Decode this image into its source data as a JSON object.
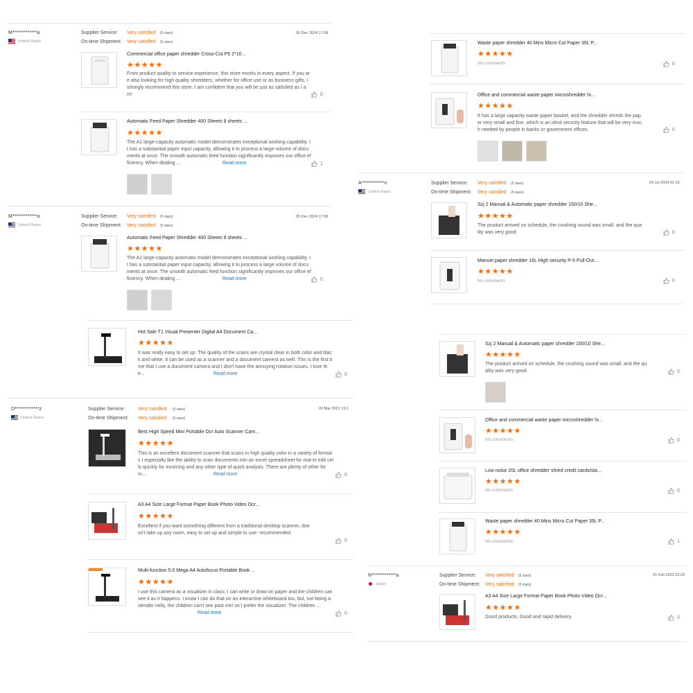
{
  "labels": {
    "supplier": "Supplier Service:",
    "ontime": "On-time Shipment:",
    "satisfied": "Very satisfied",
    "five": "(5 stars)",
    "read_more": "Read more",
    "no_comments": "No comments",
    "stars": "★★★★★"
  },
  "reviews": [
    {
      "user": "M*************a",
      "country": "United States",
      "date": "05 Dec 2024 17:58"
    },
    {
      "user": "M*************a",
      "country": "United States",
      "date": "05 Dec 2024 17:58"
    },
    {
      "user": "D*************z",
      "country": "United States",
      "date": "09 Mar 2021 19:1"
    },
    {
      "user": "A************n",
      "country": "United States",
      "date": "24 Jul 2024 01:19"
    },
    {
      "user": "N*************a",
      "country": "Japan",
      "date": "01 Feb 2023 22:29"
    }
  ],
  "items": [
    {
      "title": "Commercial office paper shredder Cross-Cut P5 2*10...",
      "text": "From product quality to service experience, this store excels in every aspect. If you are also looking for high quality shredders, whether for office use or as business gifts, I strongly recommend this store. I am confident that you will be just as satisfied as I am!",
      "likes": "0"
    },
    {
      "title": "Automatic Feed Paper Shredder 400 Sheets 8 sheets ...",
      "text": "The A1 large-capacity automatic model demonstrates exceptional working capability. It has a substantial paper input capacity, allowing it to process a large volume of documents at once. The smooth automatic feed function significantly improves our office efficiency. When dealing ...",
      "likes": "1"
    },
    {
      "title": "Automatic Feed Paper Shredder 400 Sheets 8 sheets ...",
      "text": "The A1 large-capacity automatic model demonstrates exceptional working capability. It has a substantial paper input capacity, allowing it to process a large volume of documents at once. The smooth automatic feed function significantly improves our office efficiency. When dealing ...",
      "likes": "0"
    },
    {
      "title": "Hot Sale T1 Visual Presenter Digital A4 Document Ca...",
      "text": "It was really easy to set up. The quality of the scans are crystal clear in both color and black and white. It can be used as a scanner and a document camera as well. This is the first time that I use a document camera and I don't have the annoying rotation issues. I love the...",
      "likes": "0"
    },
    {
      "title": "Best High Speed Mini Portable Ocr Auto Scanner Cam...",
      "text": "This is an excellent document scanner that scans in high quality color in a variety of formats I especially like the ability to scan documents into an excel spreadsheet for mat to edit cells quickly for invoicing and any other type of quick analysis. There are plenty of other form...",
      "likes": "0"
    },
    {
      "title": "A3 A4 Size Large Format Paper Book Photo Video Ocr...",
      "text": "Excellent if you want something different from a traditional desktop scanner, doesn't take up any room, easy to set up and simple to use- recommended.",
      "likes": "0"
    },
    {
      "title": "Multi-function 5.0 Mega A4 Autofocus Portable Book ...",
      "text": "I use this camera as a visualizer in class. I can write or draw on paper and the children can see it as it happens. I know I can do that on an interactive whiteboard too, but, not being a slender nelly, the children can't see past me! so I prefer the visualizer. The children ...",
      "likes": "0"
    },
    {
      "title": "Waste paper shredder 40 Mins Micro Cut Paper 35L P...",
      "text": "",
      "likes": "0"
    },
    {
      "title": "Office and commercial waste paper microshredder hi...",
      "text": "It has a large capacity waste paper basket, and the shredder shreds the paper very small and fine, which is an ideal security feature that will be very much needed by people in banks or government offices.",
      "likes": "0"
    },
    {
      "title": "Szj 2 Manual & Automatic paper shredder 150/10 She...",
      "text": "The product arrived on schedule, the crushing sound was small, and the quality was very good.",
      "likes": "0"
    },
    {
      "title": "Manuel paper shredder 16L High security P-5 Pull-Out...",
      "text": "",
      "likes": "0"
    },
    {
      "title": "Szj 2 Manual & Automatic paper shredder 150/10 She...",
      "text": "The product arrived on schedule, the crushing sound was small, and the quality was very good.",
      "likes": "0"
    },
    {
      "title": "Office and commercial waste paper microshredder hi...",
      "text": "",
      "likes": "0"
    },
    {
      "title": "Low noise 20L office shredder shred credit cards/sta...",
      "text": "",
      "likes": "0"
    },
    {
      "title": "Waste paper shredder 40 Mins Micro Cut Paper 35L P...",
      "text": "",
      "likes": "1"
    },
    {
      "title": "A3 A4 Size Large Format Paper Book Photo Video Ocr...",
      "text": "Good products, Good and rapid delivery.",
      "likes": "0"
    }
  ]
}
